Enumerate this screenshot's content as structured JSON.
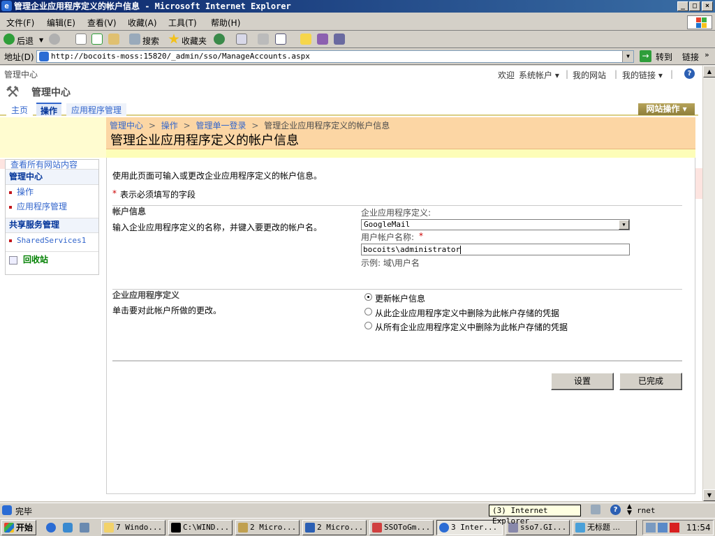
{
  "window": {
    "title": "管理企业应用程序定义的帐户信息 - Microsoft Internet Explorer",
    "minimize": "_",
    "maximize": "□",
    "close": "×"
  },
  "menu": [
    "文件(F)",
    "编辑(E)",
    "查看(V)",
    "收藏(A)",
    "工具(T)",
    "帮助(H)"
  ],
  "toolbar": {
    "back": "后退",
    "search": "搜索",
    "favorites": "收藏夹"
  },
  "address": {
    "label": "地址(D)",
    "url": "http://bocoits-moss:15820/_admin/sso/ManageAccounts.aspx",
    "go": "转到",
    "links": "链接"
  },
  "sp": {
    "site_title_small": "管理中心",
    "welcome": "欢迎",
    "user": "系统帐户",
    "my_site": "我的网站",
    "my_links": "我的链接",
    "help": "?",
    "site_title": "管理中心",
    "tabs": [
      "主页",
      "操作",
      "应用程序管理"
    ],
    "site_actions": "网站操作",
    "breadcrumb": {
      "b1": "管理中心",
      "b2": "操作",
      "b3": "管理单一登录",
      "b4": "管理企业应用程序定义的帐户信息",
      "sep": ">"
    },
    "page_title": "管理企业应用程序定义的帐户信息",
    "quicklaunch": {
      "view_all": "查看所有网站内容",
      "h1": "管理中心",
      "items1": [
        "操作",
        "应用程序管理"
      ],
      "h2": "共享服务管理",
      "items2": [
        "SharedServices1"
      ],
      "recycle": "回收站"
    },
    "intro": "使用此页面可输入或更改企业应用程序定义的帐户信息。",
    "required_star": "*",
    "required_note": "表示必须填写的字段",
    "section1": {
      "title": "帐户信息",
      "desc": "输入企业应用程序定义的名称，并键入要更改的帐户名。",
      "app_def_label": "企业应用程序定义:",
      "app_def_value": "GoogleMail",
      "account_label": "用户帐户名称:",
      "account_value": "bocoits\\administrator",
      "example": "示例: 域\\用户名"
    },
    "section2": {
      "title": "企业应用程序定义",
      "desc": "单击要对此帐户所做的更改。",
      "options": [
        "更新帐户信息",
        "从此企业应用程序定义中删除为此帐户存储的凭据",
        "从所有企业应用程序定义中删除为此帐户存储的凭据"
      ],
      "selected": 0
    },
    "buttons": {
      "set": "设置",
      "done": "已完成"
    }
  },
  "status": {
    "text": "完毕",
    "zone": "rnet",
    "tooltip": "(3) Internet Explorer"
  },
  "taskbar": {
    "start": "开始",
    "tasks": [
      "7 Windo...",
      "C:\\WIND...",
      "2 Micro...",
      "2 Micro...",
      "SSOToGm...",
      "3 Inter...",
      "sso7.GI...",
      "无标题 ..."
    ],
    "clock": "11:54"
  }
}
